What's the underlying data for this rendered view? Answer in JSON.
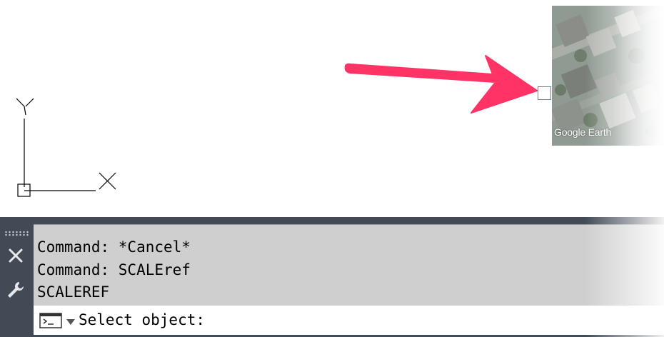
{
  "canvas": {
    "ucs": {
      "x_axis_label": "X",
      "y_axis_label": "Y"
    },
    "annotation_arrow_color": "#ff3366",
    "aerial_image": {
      "watermark": "Google Earth"
    }
  },
  "command_line": {
    "history": [
      "Command: *Cancel*",
      "Command: SCALEref",
      "SCALEREF"
    ],
    "prompt": "Select object:",
    "icons": {
      "grip": "grip-dots-icon",
      "close": "close-icon",
      "customize": "wrench-icon",
      "prompt": "command-prompt-icon",
      "dropdown": "chevron-down-icon"
    }
  }
}
